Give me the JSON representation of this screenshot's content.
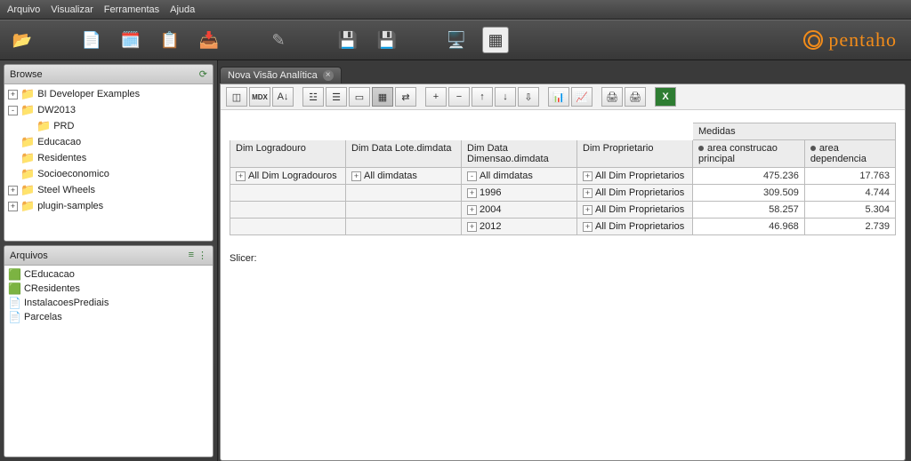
{
  "menu": {
    "items": [
      "Arquivo",
      "Visualizar",
      "Ferramentas",
      "Ajuda"
    ]
  },
  "brand": "pentaho",
  "sidebar": {
    "browse_title": "Browse",
    "files_title": "Arquivos",
    "tree": [
      {
        "indent": 0,
        "exp": "+",
        "label": "BI Developer Examples"
      },
      {
        "indent": 0,
        "exp": "-",
        "label": "DW2013"
      },
      {
        "indent": 1,
        "exp": "",
        "label": "PRD"
      },
      {
        "indent": 0,
        "exp": "",
        "label": "Educacao"
      },
      {
        "indent": 0,
        "exp": "",
        "label": "Residentes"
      },
      {
        "indent": 0,
        "exp": "",
        "label": "Socioeconomico"
      },
      {
        "indent": 0,
        "exp": "+",
        "label": "Steel Wheels"
      },
      {
        "indent": 0,
        "exp": "+",
        "label": "plugin-samples"
      }
    ],
    "files": [
      {
        "icon": "cube",
        "label": "CEducacao"
      },
      {
        "icon": "cube",
        "label": "CResidentes"
      },
      {
        "icon": "doc",
        "label": "InstalacoesPrediais"
      },
      {
        "icon": "doc",
        "label": "Parcelas"
      }
    ]
  },
  "tab": {
    "title": "Nova Visão Analítica"
  },
  "pivot": {
    "measures_label": "Medidas",
    "col_headers": [
      "Dim Logradouro",
      "Dim Data Lote.dimdata",
      "Dim Data Dimensao.dimdata",
      "Dim Proprietario"
    ],
    "measure_headers": [
      "area construcao principal",
      "area dependencia"
    ],
    "rows": [
      {
        "cells": [
          "All Dim Logradouros",
          "All dimdatas",
          "All dimdatas",
          "All Dim Proprietarios"
        ],
        "exp": [
          "+",
          "+",
          "-",
          "+"
        ],
        "vals": [
          "475.236",
          "17.763"
        ]
      },
      {
        "cells": [
          "",
          "",
          "1996",
          "All Dim Proprietarios"
        ],
        "exp": [
          "",
          "",
          "+",
          "+"
        ],
        "vals": [
          "309.509",
          "4.744"
        ]
      },
      {
        "cells": [
          "",
          "",
          "2004",
          "All Dim Proprietarios"
        ],
        "exp": [
          "",
          "",
          "+",
          "+"
        ],
        "vals": [
          "58.257",
          "5.304"
        ]
      },
      {
        "cells": [
          "",
          "",
          "2012",
          "All Dim Proprietarios"
        ],
        "exp": [
          "",
          "",
          "+",
          "+"
        ],
        "vals": [
          "46.968",
          "2.739"
        ]
      }
    ],
    "slicer_label": "Slicer:"
  },
  "pivot_toolbar": [
    "cube",
    "MDX",
    "sort",
    "cfg1",
    "cfg2",
    "cfg3",
    "grid",
    "swap",
    "r+",
    "r-",
    "c+",
    "c-",
    "drill",
    "chart1",
    "chart2",
    "print1",
    "print2",
    "excel"
  ]
}
